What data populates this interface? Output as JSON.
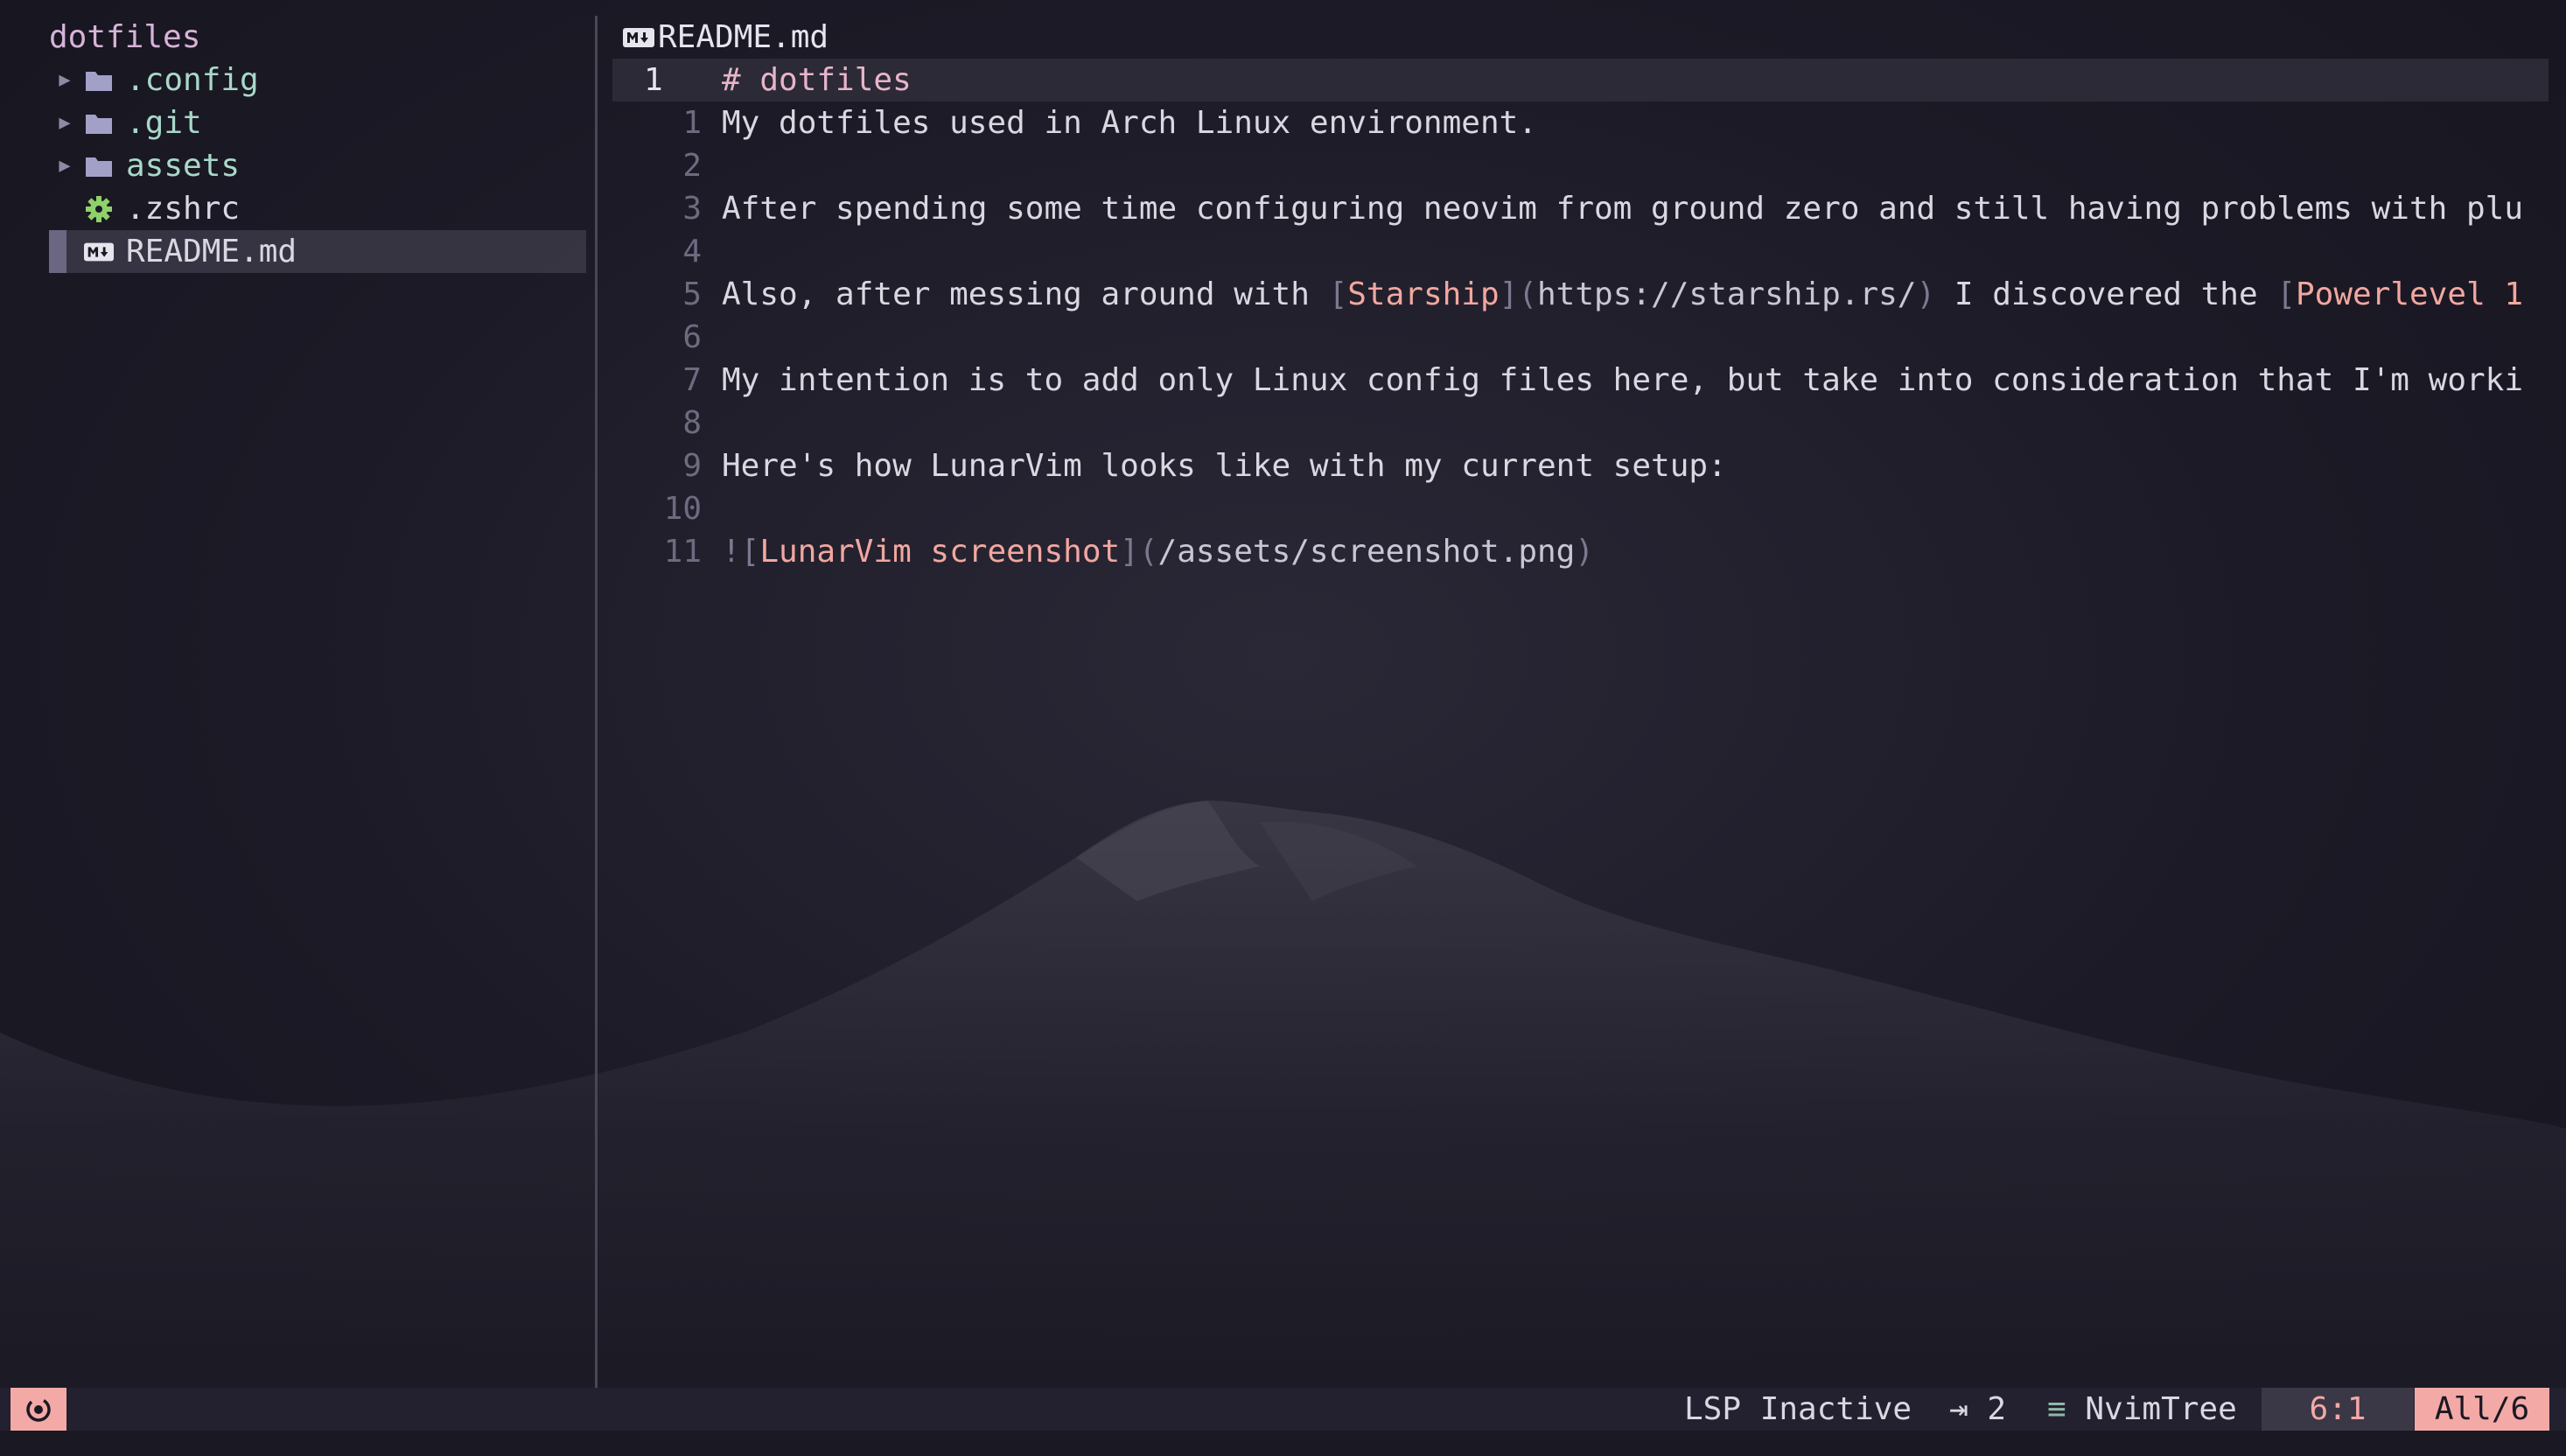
{
  "tree": {
    "root": "dotfiles",
    "items": [
      {
        "label": ".config",
        "kind": "folder",
        "icon": "folder-icon"
      },
      {
        "label": ".git",
        "kind": "folder",
        "icon": "folder-icon"
      },
      {
        "label": "assets",
        "kind": "folder",
        "icon": "folder-icon"
      },
      {
        "label": ".zshrc",
        "kind": "file",
        "icon": "gear-icon"
      },
      {
        "label": "README.md",
        "kind": "file",
        "icon": "markdown-icon",
        "selected": true
      }
    ]
  },
  "editor": {
    "title": "README.md",
    "title_icon": "markdown-icon",
    "lines": [
      {
        "num": "1",
        "current": true,
        "parts": [
          {
            "t": "# dotfiles",
            "c": "heading"
          }
        ]
      },
      {
        "num": "1",
        "parts": [
          {
            "t": "My dotfiles used in Arch Linux environment."
          }
        ]
      },
      {
        "num": "2",
        "parts": [
          {
            "t": ""
          }
        ]
      },
      {
        "num": "3",
        "parts": [
          {
            "t": "After spending some time configuring neovim from ground zero and still having problems with plu"
          }
        ]
      },
      {
        "num": "4",
        "parts": [
          {
            "t": ""
          }
        ]
      },
      {
        "num": "5",
        "parts": [
          {
            "t": "Also, after messing around with "
          },
          {
            "t": "[",
            "c": "bracket"
          },
          {
            "t": "Starship",
            "c": "link-text"
          },
          {
            "t": "](",
            "c": "bracket"
          },
          {
            "t": "https://starship.rs/",
            "c": "link-url"
          },
          {
            "t": ")",
            "c": "bracket"
          },
          {
            "t": " I discovered the "
          },
          {
            "t": "[",
            "c": "bracket"
          },
          {
            "t": "Powerlevel 1",
            "c": "link-text"
          }
        ]
      },
      {
        "num": "6",
        "parts": [
          {
            "t": ""
          }
        ]
      },
      {
        "num": "7",
        "parts": [
          {
            "t": "My intention is to add only Linux config files here, but take into consideration that I'm worki"
          }
        ]
      },
      {
        "num": "8",
        "parts": [
          {
            "t": ""
          }
        ]
      },
      {
        "num": "9",
        "parts": [
          {
            "t": "Here's how LunarVim looks like with my current setup:"
          }
        ]
      },
      {
        "num": "10",
        "parts": [
          {
            "t": ""
          }
        ]
      },
      {
        "num": "11",
        "parts": [
          {
            "t": "![",
            "c": "bracket"
          },
          {
            "t": "LunarVim screenshot",
            "c": "link-text"
          },
          {
            "t": "](",
            "c": "bracket"
          },
          {
            "t": "/assets/screenshot.png",
            "c": "link-url"
          },
          {
            "t": ")",
            "c": "bracket"
          }
        ]
      }
    ]
  },
  "statusline": {
    "mode_icon": "circle-dot-icon",
    "lsp": "LSP Inactive",
    "indent_icon": "tab-arrow-icon",
    "indent": "2",
    "filetype_icon": "lines-icon",
    "filetype": "NvimTree",
    "position": "6:1",
    "progress": "All/6"
  },
  "colors": {
    "background": "#1a1824",
    "accent_pink": "#f3a9a6",
    "folder_text": "#a9d8c8",
    "folder_icon": "#a3a0c8",
    "gear_icon": "#8fd16a",
    "root_text": "#d6b3d8"
  }
}
